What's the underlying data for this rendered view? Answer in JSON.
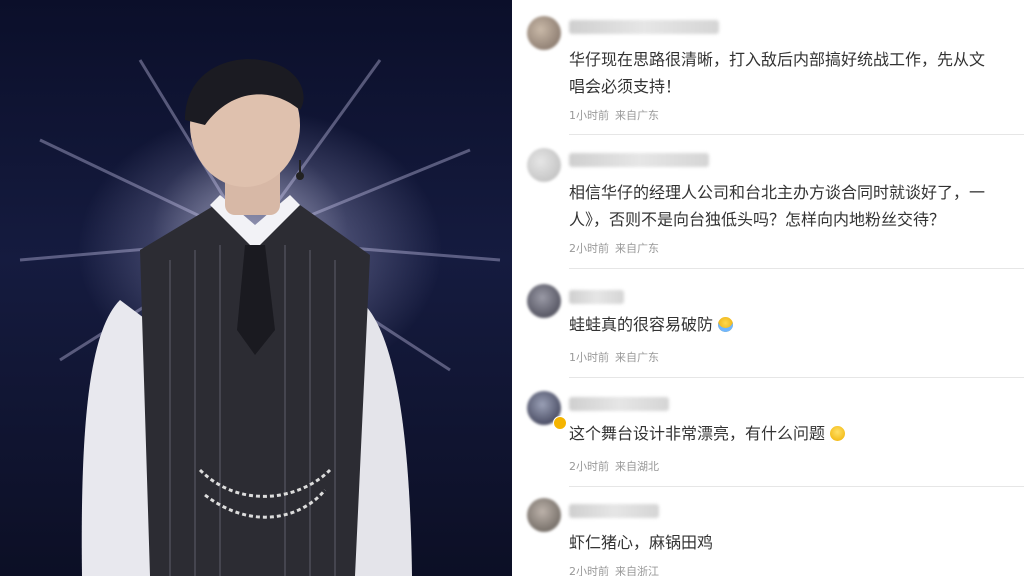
{
  "comments": [
    {
      "text_line1": "华仔现在思路很清晰，打入敌后内部搞好统战工作，先从文",
      "text_line2": "唱会必须支持！",
      "time": "1小时前",
      "location": "来自广东"
    },
    {
      "text_line1": "相信华仔的经理人公司和台北主办方谈合同时就谈好了，一",
      "text_line2": "人》，否则不是向台独低头吗？怎样向内地粉丝交待？",
      "time": "2小时前",
      "location": "来自广东"
    },
    {
      "text_line1": "蛙蛙真的很容易破防",
      "emoji": "crying-face-emoji",
      "time": "1小时前",
      "location": "来自广东"
    },
    {
      "text_line1": "这个舞台设计非常漂亮，有什么问题",
      "emoji": "grinning-face-emoji",
      "time": "2小时前",
      "location": "来自湖北"
    },
    {
      "text_line1": "虾仁猪心，麻锅田鸡",
      "time": "2小时前",
      "location": "来自浙江"
    }
  ]
}
